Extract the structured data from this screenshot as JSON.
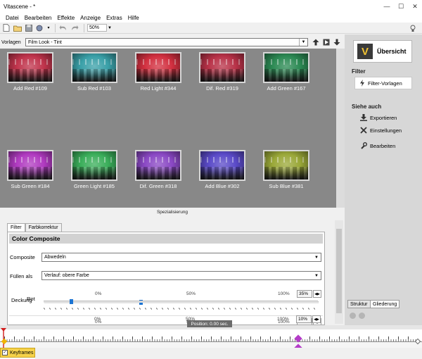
{
  "window": {
    "title": "Vitascene - *"
  },
  "menu": [
    "Datei",
    "Bearbeiten",
    "Effekte",
    "Anzeige",
    "Extras",
    "Hilfe"
  ],
  "toolbar": {
    "zoom": "50%"
  },
  "vorlagen": {
    "label": "Vorlagen",
    "selected": "Film Look - Tint"
  },
  "thumbnails": [
    {
      "caption": "Add Red #109",
      "tint": "#c0344c"
    },
    {
      "caption": "Sub Red #103",
      "tint": "#3aa0a8"
    },
    {
      "caption": "Red Light #344",
      "tint": "#d23040"
    },
    {
      "caption": "Dif. Red #319",
      "tint": "#b83248"
    },
    {
      "caption": "Add Green #167",
      "tint": "#2c8a54"
    },
    {
      "caption": "Sub Green #184",
      "tint": "#b03ac0"
    },
    {
      "caption": "Green Light #185",
      "tint": "#3aae5a"
    },
    {
      "caption": "Dif. Green #318",
      "tint": "#8a48c4"
    },
    {
      "caption": "Add Blue #302",
      "tint": "#5a4ac8"
    },
    {
      "caption": "Sub Blue #381",
      "tint": "#9aa838"
    }
  ],
  "specialization": {
    "label": "Spezialisierung"
  },
  "tabs": [
    "Filter",
    "Farbkorrektur"
  ],
  "panel": {
    "title": "Color Composite",
    "composite_label": "Composite",
    "composite_value": "Abwedeln",
    "fill_label": "Füllen als",
    "fill_value": "Verlauf: obere Farbe",
    "ticks": [
      "0%",
      "50%",
      "100%"
    ],
    "deckung_label": "Deckung",
    "deckung_value": "35%",
    "deckung_pct": 35,
    "rot_label": "Rot",
    "rot_value": "10%",
    "rot_pct": 10,
    "third_value": "10%"
  },
  "right": {
    "overview": "Übersicht",
    "filter_header": "Filter",
    "filter_templates": "Filter-Vorlagen",
    "see_also_header": "Siehe auch",
    "links": [
      "Exportieren",
      "Einstellungen",
      "Bearbeiten"
    ],
    "tabs": [
      "Struktur",
      "Gliederung"
    ]
  },
  "timeline": {
    "position": "Position: 0.00 sec.",
    "keyframes": "Keyframes"
  }
}
